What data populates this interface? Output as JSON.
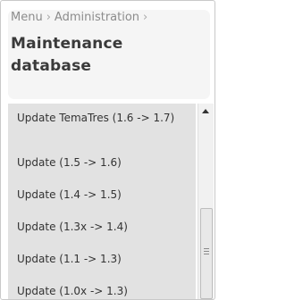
{
  "breadcrumb": {
    "items": [
      "Menu",
      "Administration"
    ],
    "separator": "›"
  },
  "page": {
    "title": "Maintenance database"
  },
  "list": {
    "items": [
      "Update TemaTres (1.6 -> 1.7)",
      "Update (1.5 -> 1.6)",
      "Update (1.4 -> 1.5)",
      "Update (1.3x -> 1.4)",
      "Update (1.1 -> 1.3)",
      "Update (1.0x -> 1.3)"
    ]
  },
  "scrollbar": {
    "up_icon": "triangle-up-icon",
    "grip_icon": "scroll-grip-icon"
  }
}
